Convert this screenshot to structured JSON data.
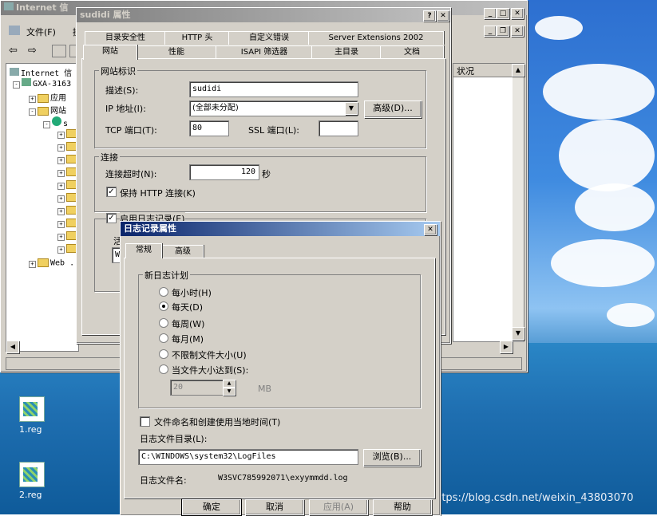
{
  "mmc": {
    "title": "Internet 信",
    "menu_file": "文件(F)",
    "menu_second": "操",
    "tree": {
      "root": "Internet 信",
      "server": "GXA-3163",
      "app_pool": "应用",
      "websites": "网站",
      "site": "s",
      "web_ext": "Web ."
    },
    "col_status": "状况"
  },
  "props": {
    "title": "sudidi 属性",
    "help_btn": "?",
    "close_btn": "✕",
    "tabs_row1": [
      "目录安全性",
      "HTTP 头",
      "自定义错误",
      "Server Extensions 2002"
    ],
    "tabs_row2": [
      "网站",
      "性能",
      "ISAPI 筛选器",
      "主目录",
      "文档"
    ],
    "group_site": "网站标识",
    "desc_label": "描述(S):",
    "desc_value": "sudidi",
    "ip_label": "IP 地址(I):",
    "ip_value": "(全部未分配)",
    "advanced_btn": "高级(D)...",
    "tcp_label": "TCP 端口(T):",
    "tcp_value": "80",
    "ssl_label": "SSL 端口(L):",
    "ssl_value": "",
    "group_conn": "连接",
    "timeout_label": "连接超时(N):",
    "timeout_value": "120",
    "timeout_unit": "秒",
    "keepalive_label": "保持 HTTP 连接(K)",
    "logging_label": "启用日志记录(E)",
    "log_fmt_partial": "活",
    "log_fmt_value_partial": "W"
  },
  "log": {
    "title": "日志记录属性",
    "close_btn": "✕",
    "tabs": [
      "常规",
      "高级"
    ],
    "group_schedule": "新日志计划",
    "options": [
      "每小时(H)",
      "每天(D)",
      "每周(W)",
      "每月(M)",
      "不限制文件大小(U)",
      "当文件大小达到(S):"
    ],
    "selected_option": 1,
    "size_value": "20",
    "size_unit": "MB",
    "local_time_label": "文件命名和创建使用当地时间(T)",
    "dir_label": "日志文件目录(L):",
    "dir_value": "C:\\WINDOWS\\system32\\LogFiles",
    "browse_btn": "浏览(B)...",
    "filename_label": "日志文件名:",
    "filename_value": "W3SVC785992071\\exyymmdd.log",
    "ok_btn": "确定",
    "cancel_btn": "取消",
    "apply_btn": "应用(A)",
    "help_btn": "帮助"
  },
  "desktop": {
    "icons": [
      "1.reg",
      "2.reg"
    ],
    "watermark": "https://blog.csdn.net/weixin_43803070"
  }
}
